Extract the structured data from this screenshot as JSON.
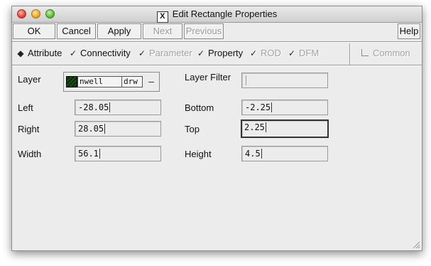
{
  "window": {
    "title": "Edit Rectangle Properties"
  },
  "toolbar": {
    "ok": "OK",
    "cancel": "Cancel",
    "apply": "Apply",
    "next": "Next",
    "previous": "Previous",
    "help": "Help"
  },
  "tabs": [
    {
      "label": "Attribute",
      "selected": true,
      "enabled": true
    },
    {
      "label": "Connectivity",
      "selected": false,
      "enabled": true
    },
    {
      "label": "Parameter",
      "selected": false,
      "enabled": false
    },
    {
      "label": "Property",
      "selected": false,
      "enabled": true
    },
    {
      "label": "ROD",
      "selected": false,
      "enabled": false
    },
    {
      "label": "DFM",
      "selected": false,
      "enabled": false
    }
  ],
  "common": {
    "label": "Common",
    "checked": false,
    "enabled": false
  },
  "form": {
    "layer": {
      "label": "Layer",
      "name": "nwell",
      "purpose": "drw"
    },
    "layer_filter": {
      "label": "Layer Filter",
      "value": ""
    },
    "left": {
      "label": "Left",
      "value": "-28.05"
    },
    "bottom": {
      "label": "Bottom",
      "value": "-2.25"
    },
    "right": {
      "label": "Right",
      "value": "28.05"
    },
    "top": {
      "label": "Top",
      "value": "2.25"
    },
    "width": {
      "label": "Width",
      "value": "56.1"
    },
    "height": {
      "label": "Height",
      "value": "4.5"
    }
  },
  "colors": {
    "window_bg": "#ececec",
    "disabled_text": "#9a9a9a",
    "swatch": "#1c4d1c"
  }
}
